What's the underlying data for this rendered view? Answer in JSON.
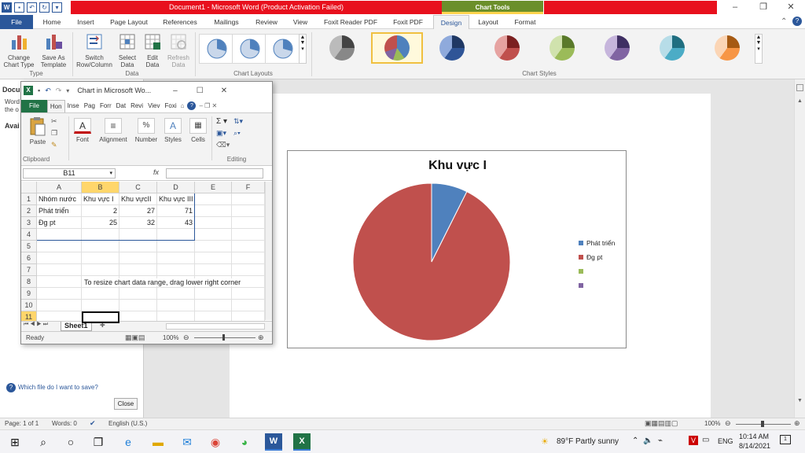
{
  "word": {
    "qat_icons": [
      "word-app-icon",
      "save-icon",
      "undo-icon",
      "redo-icon",
      "customize-icon"
    ],
    "title": "Document1 - Microsoft Word (Product Activation Failed)",
    "chart_tools_label": "Chart Tools",
    "tabs": [
      "File",
      "Home",
      "Insert",
      "Page Layout",
      "References",
      "Mailings",
      "Review",
      "View",
      "Foxit Reader PDF",
      "Foxit PDF",
      "Design",
      "Layout",
      "Format"
    ],
    "active_tab": "Design",
    "ribbon": {
      "type_group": {
        "label": "Type",
        "buttons": [
          {
            "label": "Change\nChart Type",
            "icon": "change-chart-type-icon"
          },
          {
            "label": "Save As\nTemplate",
            "icon": "save-template-icon"
          }
        ]
      },
      "data_group": {
        "label": "Data",
        "buttons": [
          {
            "label": "Switch\nRow/Column",
            "icon": "switch-row-column-icon"
          },
          {
            "label": "Select\nData",
            "icon": "select-data-icon"
          },
          {
            "label": "Edit\nData",
            "icon": "edit-data-icon"
          },
          {
            "label": "Refresh\nData",
            "icon": "refresh-data-icon"
          }
        ]
      },
      "layouts_group": {
        "label": "Chart Layouts"
      },
      "styles_group": {
        "label": "Chart Styles",
        "colors": [
          "#555555",
          "#4f81bd",
          "#2f5597",
          "#c0504d",
          "#9bbb59",
          "#8064a2",
          "#4bacc6",
          "#f79646"
        ]
      }
    },
    "left_pane": {
      "title": "Docu",
      "text1": "Word",
      "text2": "the o",
      "avail": "Avai",
      "link": "Which file do I want to save?",
      "close": "Close"
    },
    "status": {
      "page": "Page: 1 of 1",
      "words": "Words: 0",
      "language": "English (U.S.)",
      "zoom": "100%"
    }
  },
  "chart": {
    "title": "Khu vực I",
    "legend": [
      "Phát triển",
      "Đg pt",
      "",
      ""
    ],
    "legend_colors": [
      "#4f81bd",
      "#c0504d",
      "#9bbb59",
      "#8064a2"
    ]
  },
  "chart_data": {
    "type": "pie",
    "title": "Khu vực I",
    "categories": [
      "Phát triển",
      "Đg pt"
    ],
    "values": [
      2,
      25
    ],
    "colors": [
      "#4f81bd",
      "#c0504d"
    ],
    "legend_placement": "right"
  },
  "excel": {
    "title": "Chart in Microsoft Wo...",
    "tabs": [
      "File",
      "Hon",
      "Inse",
      "Pag",
      "Forr",
      "Dat",
      "Revi",
      "Viev",
      "Foxi"
    ],
    "ribbon": {
      "clipboard": "Clipboard",
      "paste": "Paste",
      "font": "Font",
      "alignment": "Alignment",
      "number": "Number",
      "styles": "Styles",
      "cells": "Cells",
      "editing": "Editing"
    },
    "namebox": "B11",
    "fx": "fx",
    "columns": [
      "A",
      "B",
      "C",
      "D",
      "E",
      "F"
    ],
    "rows": [
      "1",
      "2",
      "3",
      "4",
      "5",
      "6",
      "7",
      "8",
      "9",
      "10",
      "11"
    ],
    "cells": {
      "r1": [
        "Nhóm nước",
        "Khu vực I",
        "Khu vựcII",
        "Khu vực III",
        "",
        ""
      ],
      "r2": [
        "Phát triển",
        "2",
        "27",
        "71",
        "",
        ""
      ],
      "r3": [
        "Đg pt",
        "25",
        "32",
        "43",
        "",
        ""
      ]
    },
    "note": "To resize chart data range, drag lower right corner",
    "sheet": "Sheet1",
    "status": "Ready",
    "zoom": "100%"
  },
  "taskbar": {
    "weather": "89°F  Partly sunny",
    "lang": "ENG",
    "time": "10:14 AM",
    "date": "8/14/2021"
  }
}
